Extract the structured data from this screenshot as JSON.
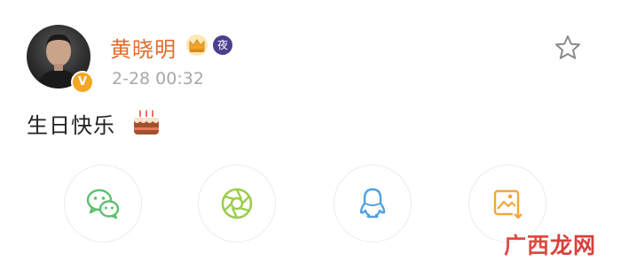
{
  "post": {
    "username": "黄晓明",
    "timestamp": "2-28 00:32",
    "text": "生日快乐",
    "emoji": "birthday-cake",
    "badges": {
      "verified": "V",
      "night": "夜"
    }
  },
  "share_options": [
    {
      "icon": "wechat-icon",
      "color": "#5fbf6f"
    },
    {
      "icon": "moments-icon",
      "color": "#9ccd4e"
    },
    {
      "icon": "qq-icon",
      "color": "#4fa3df"
    },
    {
      "icon": "save-image-icon",
      "color": "#f0a83a"
    }
  ],
  "watermark": {
    "text_a": "广西",
    "text_b": "龙网"
  },
  "colors": {
    "username": "#e26b2b",
    "timestamp": "#a8a8a8",
    "verified": "#f5a623"
  }
}
